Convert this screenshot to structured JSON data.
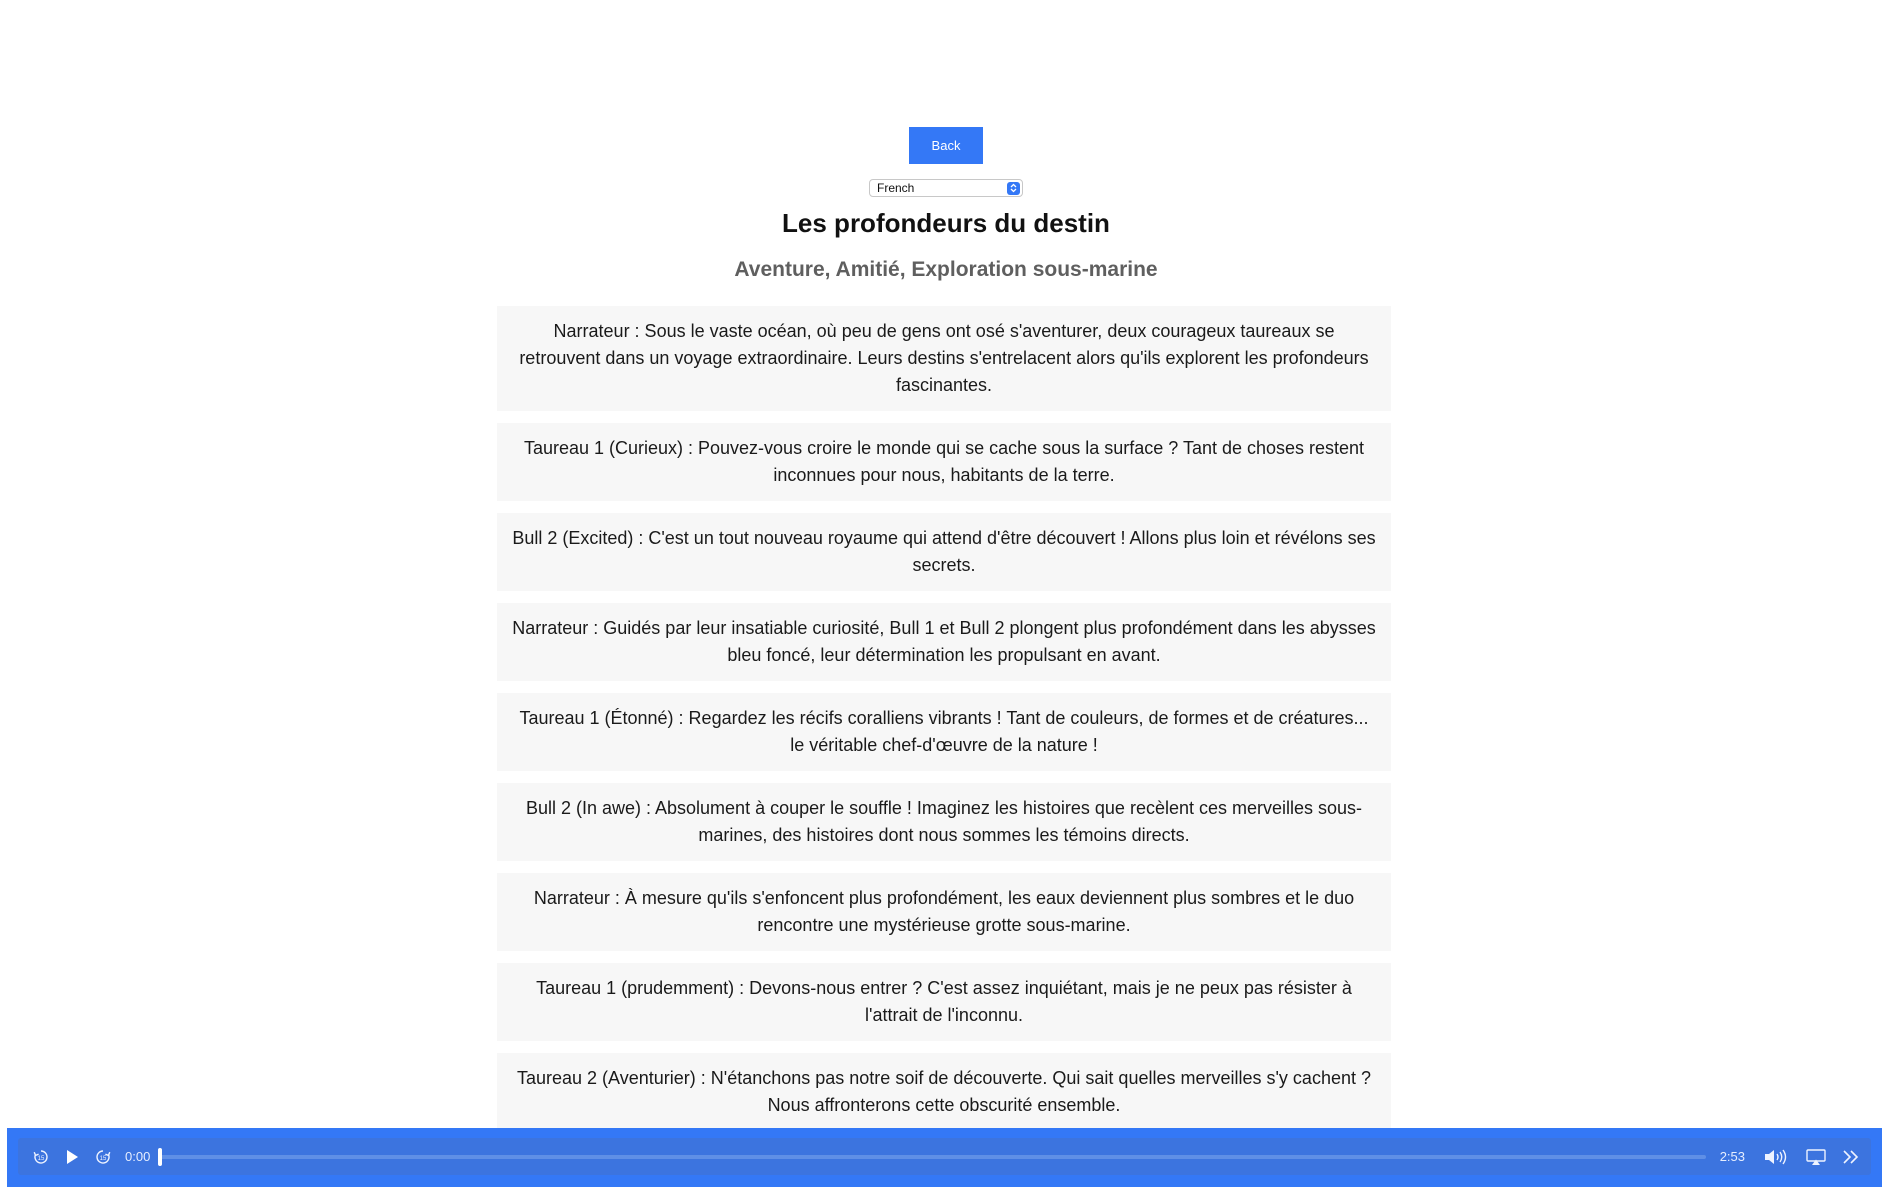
{
  "header": {
    "back_label": "Back",
    "language": "French"
  },
  "story": {
    "title": "Les profondeurs du destin",
    "tags": "Aventure, Amitié, Exploration sous-marine",
    "lines": [
      "Narrateur : Sous le vaste océan, où peu de gens ont osé s'aventurer, deux courageux taureaux se retrouvent dans un voyage extraordinaire. Leurs destins s'entrelacent alors qu'ils explorent les profondeurs fascinantes.",
      "Taureau 1 (Curieux) : Pouvez-vous croire le monde qui se cache sous la surface ? Tant de choses restent inconnues pour nous, habitants de la terre.",
      "Bull 2 (Excited) : C'est un tout nouveau royaume qui attend d'être découvert ! Allons plus loin et révélons ses secrets.",
      "Narrateur : Guidés par leur insatiable curiosité, Bull 1 et Bull 2 plongent plus profondément dans les abysses bleu foncé, leur détermination les propulsant en avant.",
      "Taureau 1 (Étonné) : Regardez les récifs coralliens vibrants ! Tant de couleurs, de formes et de créatures... le véritable chef-d'œuvre de la nature !",
      "Bull 2 (In awe) : Absolument à couper le souffle ! Imaginez les histoires que recèlent ces merveilles sous-marines, des histoires dont nous sommes les témoins directs.",
      "Narrateur : À mesure qu'ils s'enfoncent plus profondément, les eaux deviennent plus sombres et le duo rencontre une mystérieuse grotte sous-marine.",
      "Taureau 1 (prudemment) : Devons-nous entrer ? C'est assez inquiétant, mais je ne peux pas résister à l'attrait de l'inconnu.",
      "Taureau 2 (Aventurier) : N'étanchons pas notre soif de découverte. Qui sait quelles merveilles s'y cachent ? Nous affronterons cette obscurité ensemble."
    ]
  },
  "player": {
    "current_time": "0:00",
    "duration": "2:53",
    "progress_fraction": 0,
    "icons": [
      "rewind-15-icon",
      "play-icon",
      "forward-15-icon",
      "volume-icon",
      "airplay-icon",
      "playback-speed-icon"
    ],
    "accent_color": "#3478f6"
  }
}
